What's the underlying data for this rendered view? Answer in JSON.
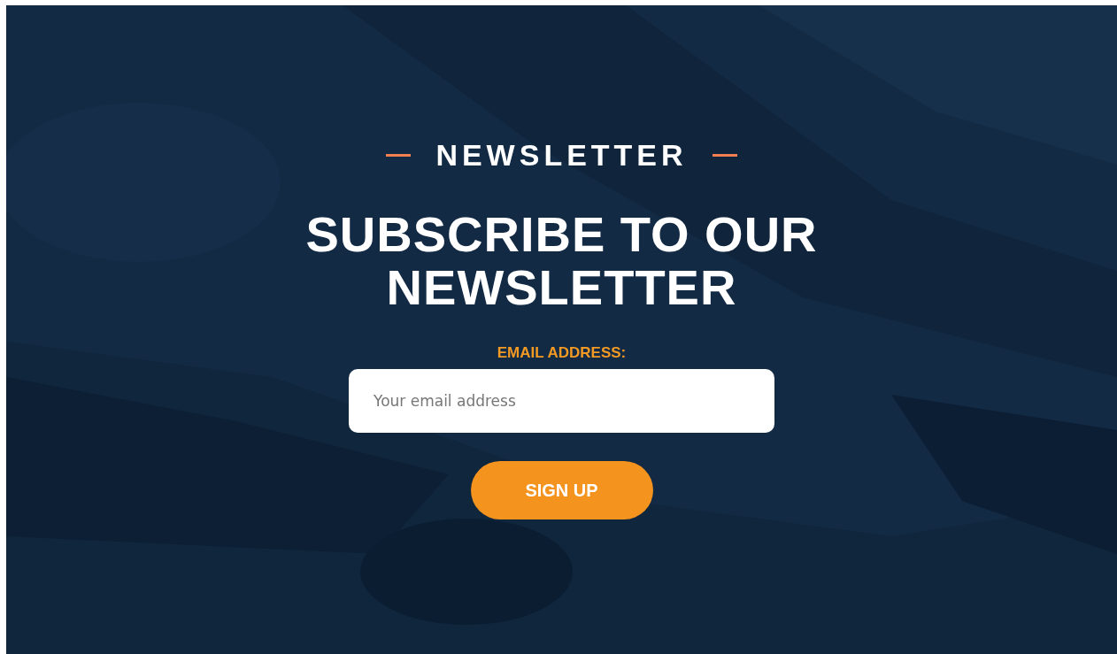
{
  "eyebrow": "NEWSLETTER",
  "heading": "SUBSCRIBE TO OUR NEWSLETTER",
  "email_field": {
    "label": "EMAIL ADDRESS:",
    "placeholder": "Your email address"
  },
  "buttons": [
    "SIGN UP"
  ]
}
